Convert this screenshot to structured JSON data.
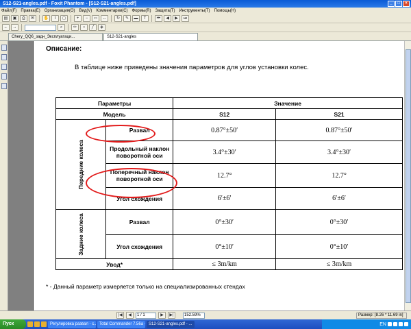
{
  "window": {
    "title": "S12-S21-angles.pdf - Foxit Phantom - [S12-S21-angles.pdf]"
  },
  "menu": [
    "Файл(F)",
    "Правка(E)",
    "Организация(O)",
    "Вид(V)",
    "Комментарии(C)",
    "Формы(R)",
    "Защита(T)",
    "Инструменты(T)",
    "Помощь(H)"
  ],
  "tabs": [
    "Chery_QQ6_задн_Эксплуатаци...",
    "S12-S21-angles"
  ],
  "document": {
    "heading": "Описание:",
    "intro": "В таблице ниже приведены значения параметров для углов установки колес.",
    "table": {
      "header_params": "Параметры",
      "header_value": "Значение",
      "model_label": "Модель",
      "models": [
        "S12",
        "S21"
      ],
      "front_group": "Передние колеса",
      "rear_group": "Задние колеса",
      "rows": [
        {
          "label": "Развал",
          "s12": "0.87°±50′",
          "s21": "0.87°±50′"
        },
        {
          "label": "Продольный наклон поворотной оси",
          "s12": "3.4°±30′",
          "s21": "3.4°±30′"
        },
        {
          "label": "Поперечный наклон поворотной оси",
          "s12": "12.7°",
          "s21": "12.7°"
        },
        {
          "label": "Угол схождения",
          "s12": "6′±6′",
          "s21": "6′±6′"
        },
        {
          "label": "Развал",
          "s12": "0°±30′",
          "s21": "0°±30′"
        },
        {
          "label": "Угол схождения",
          "s12": "0°±10′",
          "s21": "0°±10′"
        }
      ],
      "drift_label": "Увод*",
      "drift_s12": "≤ 3m/km",
      "drift_s21": "≤ 3m/km"
    },
    "footnote": "* - Данный параметр измеряется только на специализированных стендах"
  },
  "status": {
    "page": "1 / 1",
    "zoom": "152.59%",
    "size": "Размер: [8.26 * 11.69 in]"
  },
  "taskbar": {
    "start": "Пуск",
    "tasks": [
      "Регулировка развал - с...",
      "Total Commander 7.56a - ...",
      "S12-S21-angles.pdf - ..."
    ],
    "tray_lang": "EN"
  },
  "colors": {
    "annotation_ring": "#e21b1b",
    "titlebar": "#0a5bd6"
  }
}
